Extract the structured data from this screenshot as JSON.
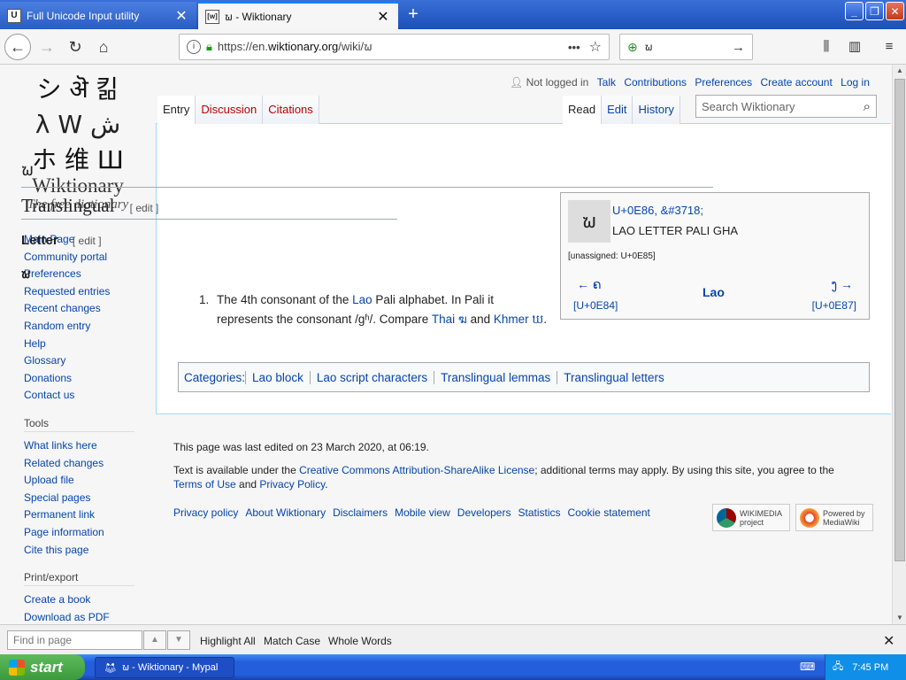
{
  "browser": {
    "tabs": [
      {
        "favicon": "U",
        "title": "Full Unicode Input utility",
        "active": false
      },
      {
        "favicon": "[w]",
        "title": "ຆ - Wiktionary",
        "active": true
      }
    ],
    "url_prefix": "https://en.",
    "url_domain": "wiktionary.org",
    "url_suffix": "/wiki/ຆ",
    "search_value": "ຆ",
    "colors": {
      "titlebar": "#245edb",
      "link": "#0645ad"
    }
  },
  "wiki": {
    "logo_glyphs": [
      "シ ऄ 킮",
      "λ W ش",
      "ホ 维 Ш"
    ],
    "logo_name": "Wiktionary",
    "logo_tagline": "The free dictionary",
    "nav": [
      "Main Page",
      "Community portal",
      "Preferences",
      "Requested entries",
      "Recent changes",
      "Random entry",
      "Help",
      "Glossary",
      "Donations",
      "Contact us"
    ],
    "tools_heading": "Tools",
    "tools": [
      "What links here",
      "Related changes",
      "Upload file",
      "Special pages",
      "Permanent link",
      "Page information",
      "Cite this page"
    ],
    "print_heading": "Print/export",
    "print": [
      "Create a book",
      "Download as PDF"
    ],
    "user_tools": {
      "not_logged_in": "Not logged in",
      "talk": "Talk",
      "contributions": "Contributions",
      "preferences": "Preferences",
      "create_account": "Create account",
      "log_in": "Log in"
    },
    "tabs_left": [
      "Entry",
      "Discussion",
      "Citations"
    ],
    "tabs_right": [
      "Read",
      "Edit",
      "History"
    ],
    "search_placeholder": "Search Wiktionary",
    "page_title": "ຆ",
    "section_translingual": "Translingual",
    "edit_label": "[ edit ]",
    "section_letter": "Letter",
    "headword": "ຆ",
    "definition": {
      "number": "1.",
      "pre": "The 4th consonant of the ",
      "link_lao": "Lao",
      "mid": " Pali alphabet. In Pali it represents the consonant /gʱ/. Compare ",
      "link_thai": "Thai ฆ",
      "and": " and ",
      "link_khmer": "Khmer ឃ",
      "end": "."
    },
    "infobox": {
      "glyph": "ຆ",
      "codepoint": "U+0E86, &#3718;",
      "name": "LAO LETTER PALI GHA",
      "unassigned": "[unassigned: U+0E85]",
      "prev": "← ຄ",
      "prev_cp": "[U+0E84]",
      "block": "Lao",
      "next": "ງ →",
      "next_cp": "[U+0E87]"
    },
    "categories_label": "Categories:",
    "categories": [
      "Lao block",
      "Lao script characters",
      "Translingual lemmas",
      "Translingual letters"
    ],
    "footer": {
      "last_edited": "This page was last edited on 23 March 2020, at 06:19.",
      "license_pre": "Text is available under the ",
      "license_link": "Creative Commons Attribution-ShareAlike License",
      "license_mid": "; additional terms may apply. By using this site, you agree to the ",
      "terms_link": "Terms of Use",
      "and": " and ",
      "privacy_link": "Privacy Policy",
      "end": ".",
      "links": [
        "Privacy policy",
        "About Wiktionary",
        "Disclaimers",
        "Mobile view",
        "Developers",
        "Statistics",
        "Cookie statement"
      ],
      "badge_wikimedia": "WIKIMEDIA project",
      "badge_mediawiki": "Powered by MediaWiki"
    }
  },
  "findbar": {
    "placeholder": "Find in page",
    "highlight": "Highlight All",
    "match_case": "Match Case",
    "whole_words": "Whole Words"
  },
  "taskbar": {
    "start": "start",
    "item": "ຆ - Wiktionary - Mypal",
    "time": "7:45 PM"
  }
}
